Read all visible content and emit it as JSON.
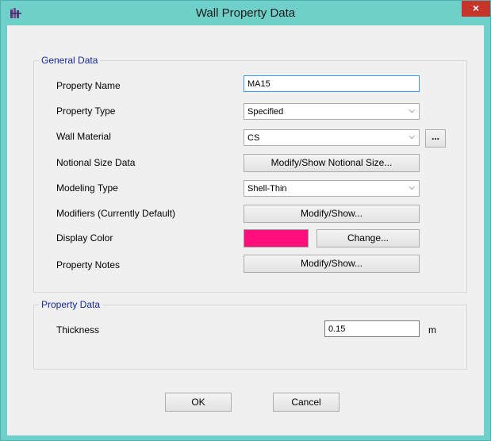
{
  "window": {
    "title": "Wall Property Data",
    "close_glyph": "×"
  },
  "general": {
    "legend": "General Data",
    "property_name": {
      "label": "Property Name",
      "value": "MA15"
    },
    "property_type": {
      "label": "Property Type",
      "value": "Specified"
    },
    "wall_material": {
      "label": "Wall Material",
      "value": "CS",
      "browse_label": "..."
    },
    "notional_size": {
      "label": "Notional Size Data",
      "button": "Modify/Show Notional Size..."
    },
    "modeling_type": {
      "label": "Modeling Type",
      "value": "Shell-Thin"
    },
    "modifiers": {
      "label": "Modifiers (Currently Default)",
      "button": "Modify/Show..."
    },
    "display_color": {
      "label": "Display Color",
      "color": "#ff0f7b",
      "button": "Change..."
    },
    "property_notes": {
      "label": "Property Notes",
      "button": "Modify/Show..."
    }
  },
  "property_data": {
    "legend": "Property Data",
    "thickness": {
      "label": "Thickness",
      "value": "0.15",
      "unit": "m"
    }
  },
  "footer": {
    "ok_label": "OK",
    "cancel_label": "Cancel"
  },
  "icons": {
    "dropdown": "chevron-down-icon",
    "app": "etabs-app-icon",
    "close": "close-icon"
  }
}
